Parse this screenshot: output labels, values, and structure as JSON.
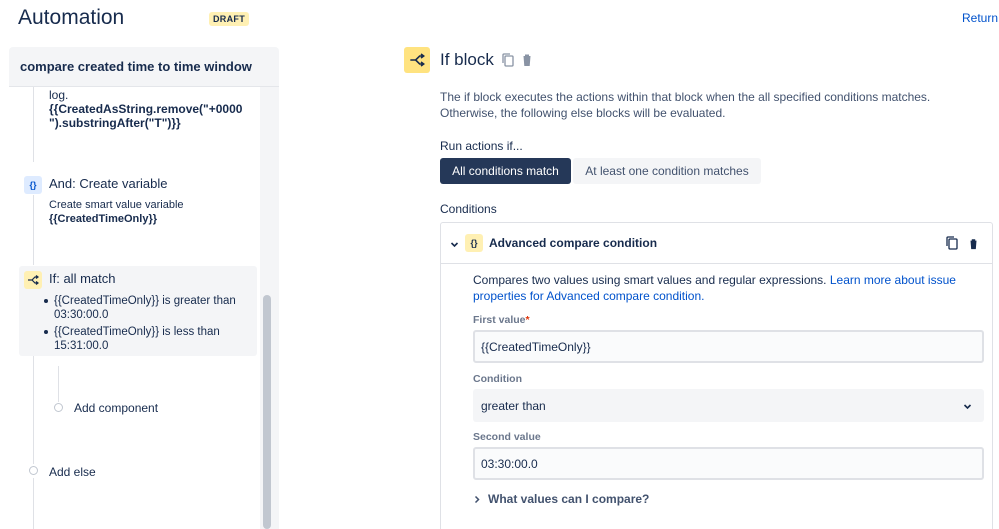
{
  "header": {
    "title": "Automation",
    "badge": "DRAFT",
    "return_label": "Return"
  },
  "rule": {
    "title": "compare created time to time window",
    "log_prefix": "log.",
    "log_expression": "{{CreatedAsString.remove(\"+0000 \").substringAfter(\"T\")}}",
    "create_var": {
      "icon_text": "{}",
      "title": "And: Create variable",
      "desc": "Create smart value variable",
      "var_name": "{{CreatedTimeOnly}}"
    },
    "if_block": {
      "title": "If: all match",
      "conditions": [
        "{{CreatedTimeOnly}} is greater than 03:30:00.0",
        "{{CreatedTimeOnly}} is less than 15:31:00.0"
      ]
    },
    "add_component": "Add component",
    "add_else": "Add else"
  },
  "detail": {
    "title": "If block",
    "description": "The if block executes the actions within that block when the all specified conditions matches. Otherwise, the following else blocks will be evaluated.",
    "run_label": "Run actions if...",
    "options": [
      "All conditions match",
      "At least one condition matches"
    ],
    "conditions_label": "Conditions",
    "condition": {
      "icon_text": "{}",
      "title": "Advanced compare condition",
      "desc": "Compares two values using smart values and regular expressions.",
      "link": "Learn more about issue properties for Advanced compare condition.",
      "first_label": "First value",
      "required_mark": "*",
      "first_value": "{{CreatedTimeOnly}}",
      "condition_label": "Condition",
      "condition_value": "greater than",
      "second_label": "Second value",
      "second_value": "03:30:00.0",
      "expand_label": "What values can I compare?"
    }
  }
}
